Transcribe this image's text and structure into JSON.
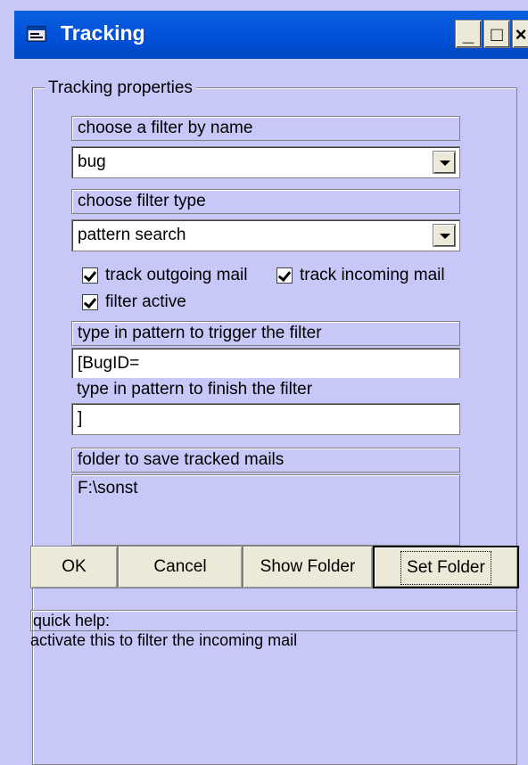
{
  "window": {
    "title": "Tracking",
    "min_label": "_",
    "max_label": "□",
    "close_label": "×"
  },
  "group": {
    "legend": "Tracking properties"
  },
  "filter_name": {
    "label": "choose a filter by name",
    "value": "bug"
  },
  "filter_type": {
    "label": "choose filter type",
    "value": "pattern search"
  },
  "checkboxes": {
    "track_outgoing": "track outgoing mail",
    "track_incoming": "track incoming mail",
    "filter_active": "filter active"
  },
  "trigger": {
    "label": "type in pattern to trigger the filter",
    "value": "[BugID="
  },
  "finish": {
    "label": "type in pattern to finish the filter",
    "value": "]"
  },
  "folder": {
    "label": "folder to save tracked mails",
    "value": "F:\\sonst"
  },
  "buttons": {
    "ok": "OK",
    "cancel": "Cancel",
    "show_folder": "Show Folder",
    "set_folder": "Set Folder"
  },
  "help": {
    "label": "quick help:",
    "text": "activate this to filter the incoming mail"
  }
}
